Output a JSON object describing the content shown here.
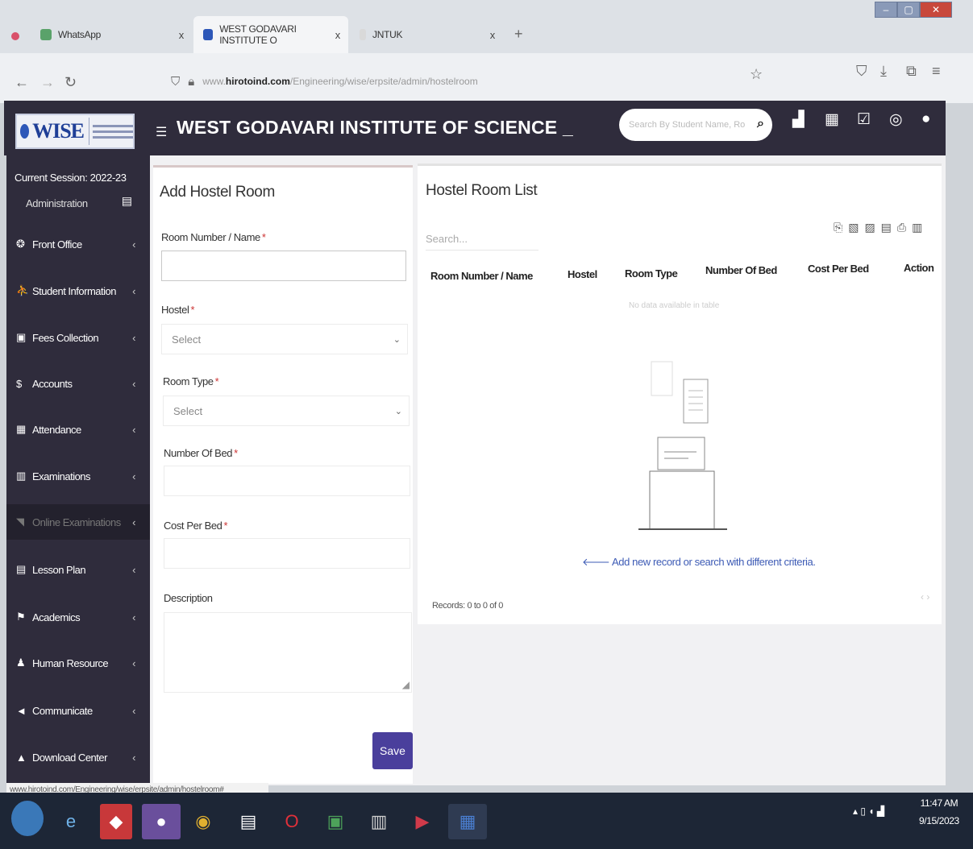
{
  "browser": {
    "tabs": [
      {
        "label": "WhatsApp"
      },
      {
        "label": "WEST GODAVARI INSTITUTE O"
      },
      {
        "label": "JNTUK"
      }
    ],
    "tab_close": "x",
    "new_tab": "+",
    "url_host": "hirotoind.com",
    "url_prefix": "www.",
    "url_path": "/Engineering/wise/erpsite/admin/hostelroom"
  },
  "header": {
    "logo_text": "WISE",
    "title": "WEST GODAVARI INSTITUTE OF SCIENCE _",
    "search_placeholder": "Search By Student Name, Ro"
  },
  "sidebar": {
    "session": "Current Session: 2022-23",
    "role": "Administration",
    "items": [
      {
        "label": "Front Office"
      },
      {
        "label": "Student Information"
      },
      {
        "label": "Fees Collection"
      },
      {
        "label": "Accounts"
      },
      {
        "label": "Attendance"
      },
      {
        "label": "Examinations"
      },
      {
        "label": "Online Examinations"
      },
      {
        "label": "Lesson Plan"
      },
      {
        "label": "Academics"
      },
      {
        "label": "Human Resource"
      },
      {
        "label": "Communicate"
      },
      {
        "label": "Download Center"
      }
    ]
  },
  "form": {
    "title": "Add Hostel Room",
    "room_number_label": "Room Number / Name",
    "hostel_label": "Hostel",
    "hostel_value": "Select",
    "room_type_label": "Room Type",
    "room_type_value": "Select",
    "number_of_bed_label": "Number Of Bed",
    "cost_per_bed_label": "Cost Per Bed",
    "description_label": "Description",
    "required_mark": "*",
    "save_label": "Save"
  },
  "list": {
    "title": "Hostel Room List",
    "search_placeholder": "Search...",
    "columns": [
      "Room Number / Name",
      "Hostel",
      "Room Type",
      "Number Of Bed",
      "Cost Per Bed",
      "Action"
    ],
    "no_data": "No data available in table",
    "add_hint": "Add new record or search with different criteria.",
    "records": "Records: 0 to 0 of 0",
    "pager": "‹  ›"
  },
  "statusbar": {
    "url": "www.hirotoind.com/Engineering/wise/erpsite/admin/hostelroom#"
  },
  "taskbar": {
    "time": "11:47 AM",
    "date": "9/15/2023"
  }
}
